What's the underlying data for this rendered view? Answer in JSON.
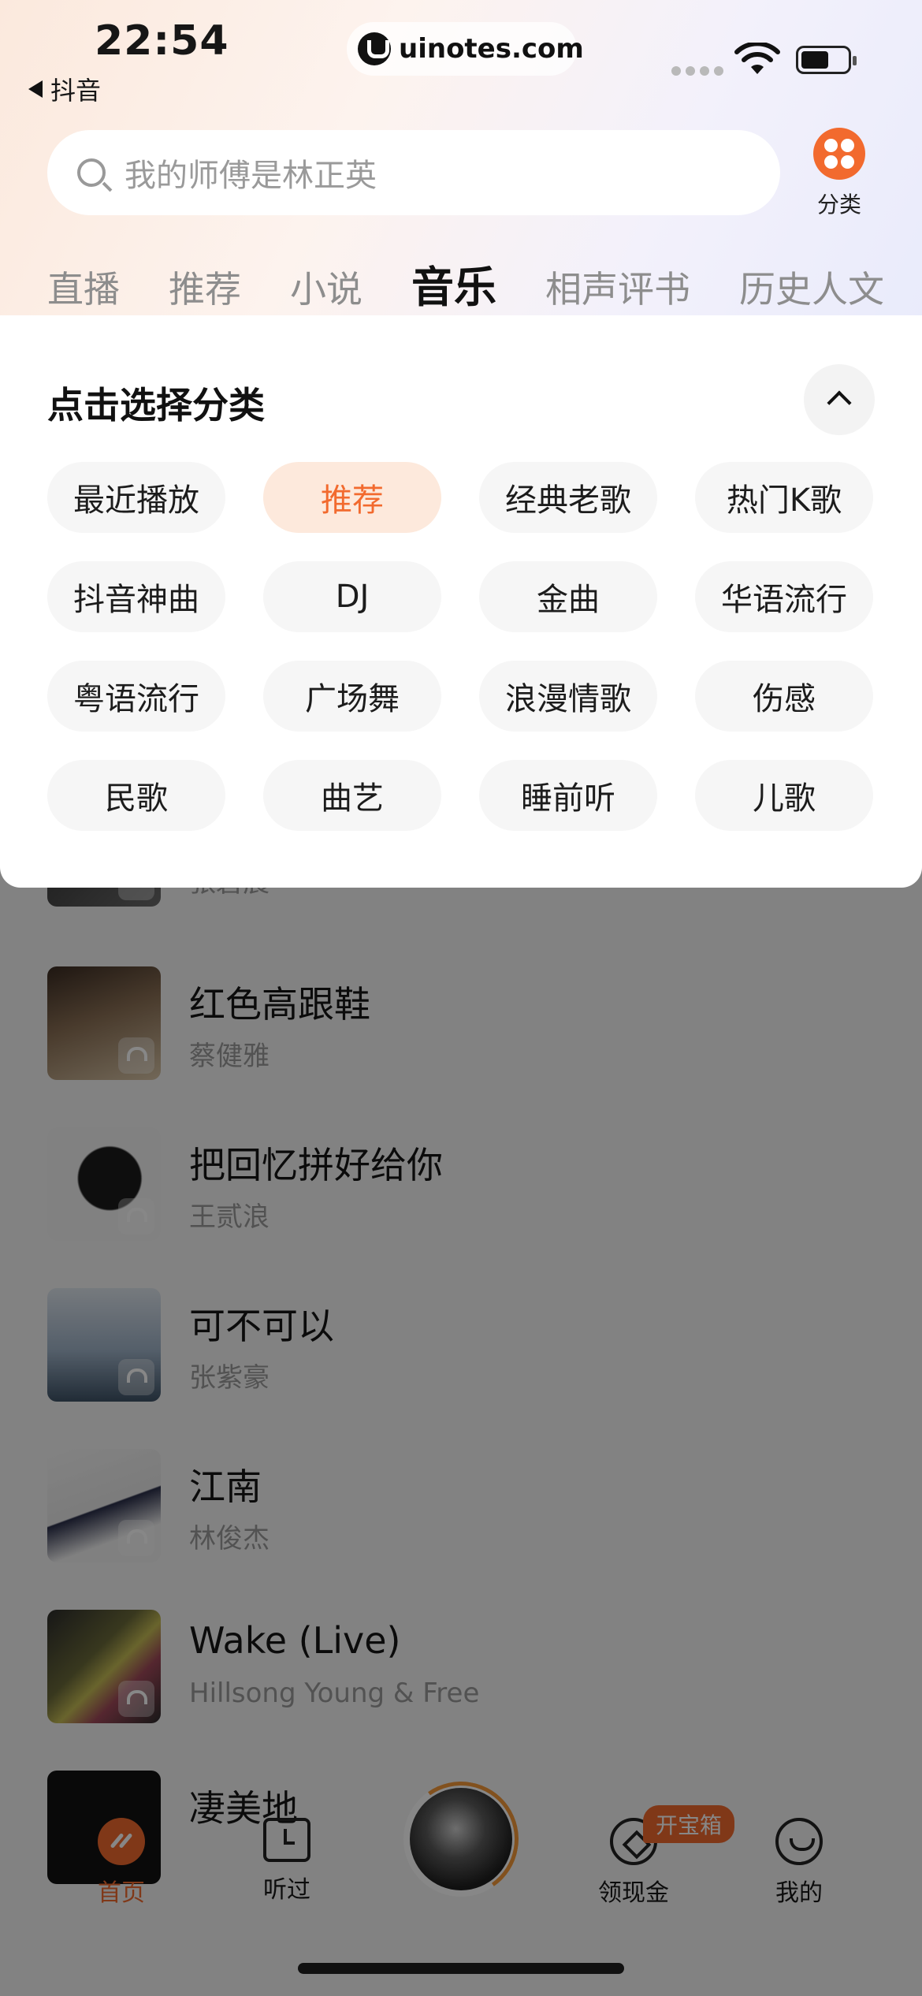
{
  "status_bar": {
    "time": "22:54",
    "back_app": "抖音",
    "url": "uinotes.com"
  },
  "search": {
    "placeholder": "我的师傅是林正英"
  },
  "category_button": {
    "label": "分类",
    "icon": "grid-dots-icon"
  },
  "tabs": [
    {
      "label": "直播"
    },
    {
      "label": "推荐"
    },
    {
      "label": "小说"
    },
    {
      "label": "音乐",
      "active": true
    },
    {
      "label": "相声评书"
    },
    {
      "label": "历史人文"
    }
  ],
  "panel": {
    "title": "点击选择分类",
    "chips": [
      "最近播放",
      "推荐",
      "经典老歌",
      "热门K歌",
      "抖音神曲",
      "DJ",
      "金曲",
      "华语流行",
      "粤语流行",
      "广场舞",
      "浪漫情歌",
      "伤感",
      "民歌",
      "曲艺",
      "睡前听",
      "儿歌"
    ],
    "selected": "推荐"
  },
  "songs": [
    {
      "title": "",
      "artist": "张碧晨",
      "colors": [
        "#2a2a2a",
        "#6a6a6a"
      ]
    },
    {
      "title": "红色高跟鞋",
      "artist": "蔡健雅",
      "colors": [
        "#5a4636",
        "#c9b69a"
      ]
    },
    {
      "title": "把回忆拼好给你",
      "artist": "王贰浪",
      "colors": [
        "#f4f4f4",
        "#1c1c1c"
      ]
    },
    {
      "title": "可不可以",
      "artist": "张紫豪",
      "colors": [
        "#c9d5e4",
        "#50677f"
      ]
    },
    {
      "title": "江南",
      "artist": "林俊杰",
      "colors": [
        "#f1f1f1",
        "#2b2f4a"
      ]
    },
    {
      "title": "Wake (Live)",
      "artist": "Hillsong Young & Free",
      "colors": [
        "#2c2c2c",
        "#b5b04a"
      ]
    },
    {
      "title": "凄美地",
      "artist": "",
      "colors": [
        "#111111",
        "#444444"
      ]
    }
  ],
  "bottom_nav": {
    "home": "首页",
    "history": "听过",
    "earn": "领现金",
    "me": "我的",
    "badge": "开宝箱"
  },
  "colors": {
    "accent": "#f26a2e",
    "chip_bg": "#f6f6f6",
    "chip_selected_bg": "#fde9dc"
  }
}
